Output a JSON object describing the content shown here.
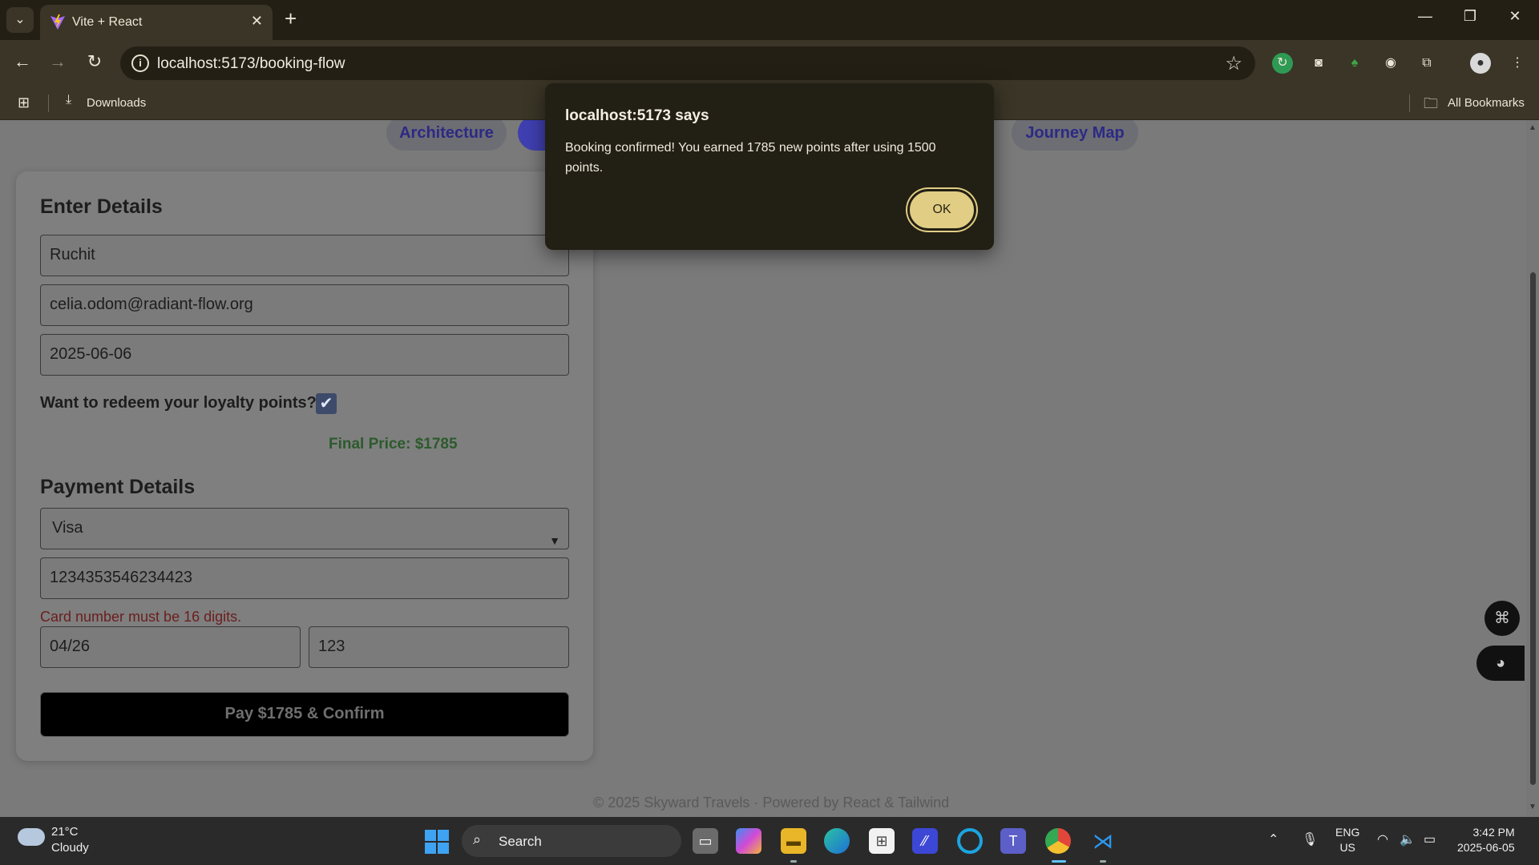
{
  "browser": {
    "tab_title": "Vite + React",
    "url": "localhost:5173/booking-flow",
    "bookmarks": {
      "downloads": "Downloads",
      "all_bookmarks": "All Bookmarks"
    }
  },
  "nav_pills": [
    "Architecture",
    "B",
    "Journey Map"
  ],
  "form": {
    "heading": "Enter Details",
    "name_value": "Ruchit",
    "email_value": "celia.odom@radiant-flow.org",
    "date_value": "2025-06-06",
    "redeem_label": "Want to redeem your loyalty points?",
    "redeem_checked": true,
    "final_price": "Final Price: $1785",
    "payment_heading": "Payment Details",
    "card_type": "Visa",
    "card_number": "1234353546234423",
    "card_error": "Card number must be 16 digits.",
    "expiry": "04/26",
    "cvv": "123",
    "pay_button": "Pay $1785 & Confirm"
  },
  "footer": "© 2025 Skyward Travels · Powered by React & Tailwind",
  "dialog": {
    "title": "localhost:5173 says",
    "message": "Booking confirmed! You earned 1785 new points after using 1500 points.",
    "ok_label": "OK"
  },
  "taskbar": {
    "temperature": "21°C",
    "weather": "Cloudy",
    "search_label": "Search",
    "lang_line1": "ENG",
    "lang_line2": "US",
    "time": "3:42 PM",
    "date": "2025-06-05"
  },
  "colors": {
    "dialog_bg": "#221f14",
    "ok_button": "#e1ce84",
    "error_text": "#6b1e1e",
    "price_text": "#2d5a2d"
  }
}
